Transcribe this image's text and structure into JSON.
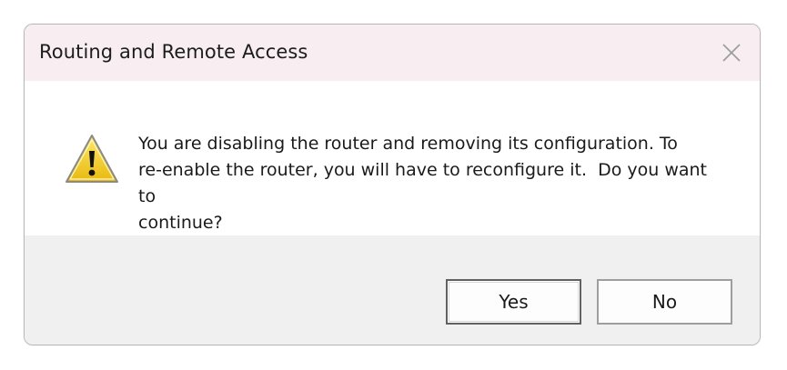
{
  "dialog": {
    "title": "Routing and Remote Access",
    "icon": "warning-icon",
    "message": "You are disabling the router and removing its configuration. To\nre-enable the router, you will have to reconfigure it.  Do you want to\ncontinue?",
    "buttons": {
      "yes": "Yes",
      "no": "No"
    }
  },
  "colors": {
    "titlebar": "#f8eef2",
    "footer": "#f0f0f0",
    "warning_fill": "#f7d51d"
  }
}
